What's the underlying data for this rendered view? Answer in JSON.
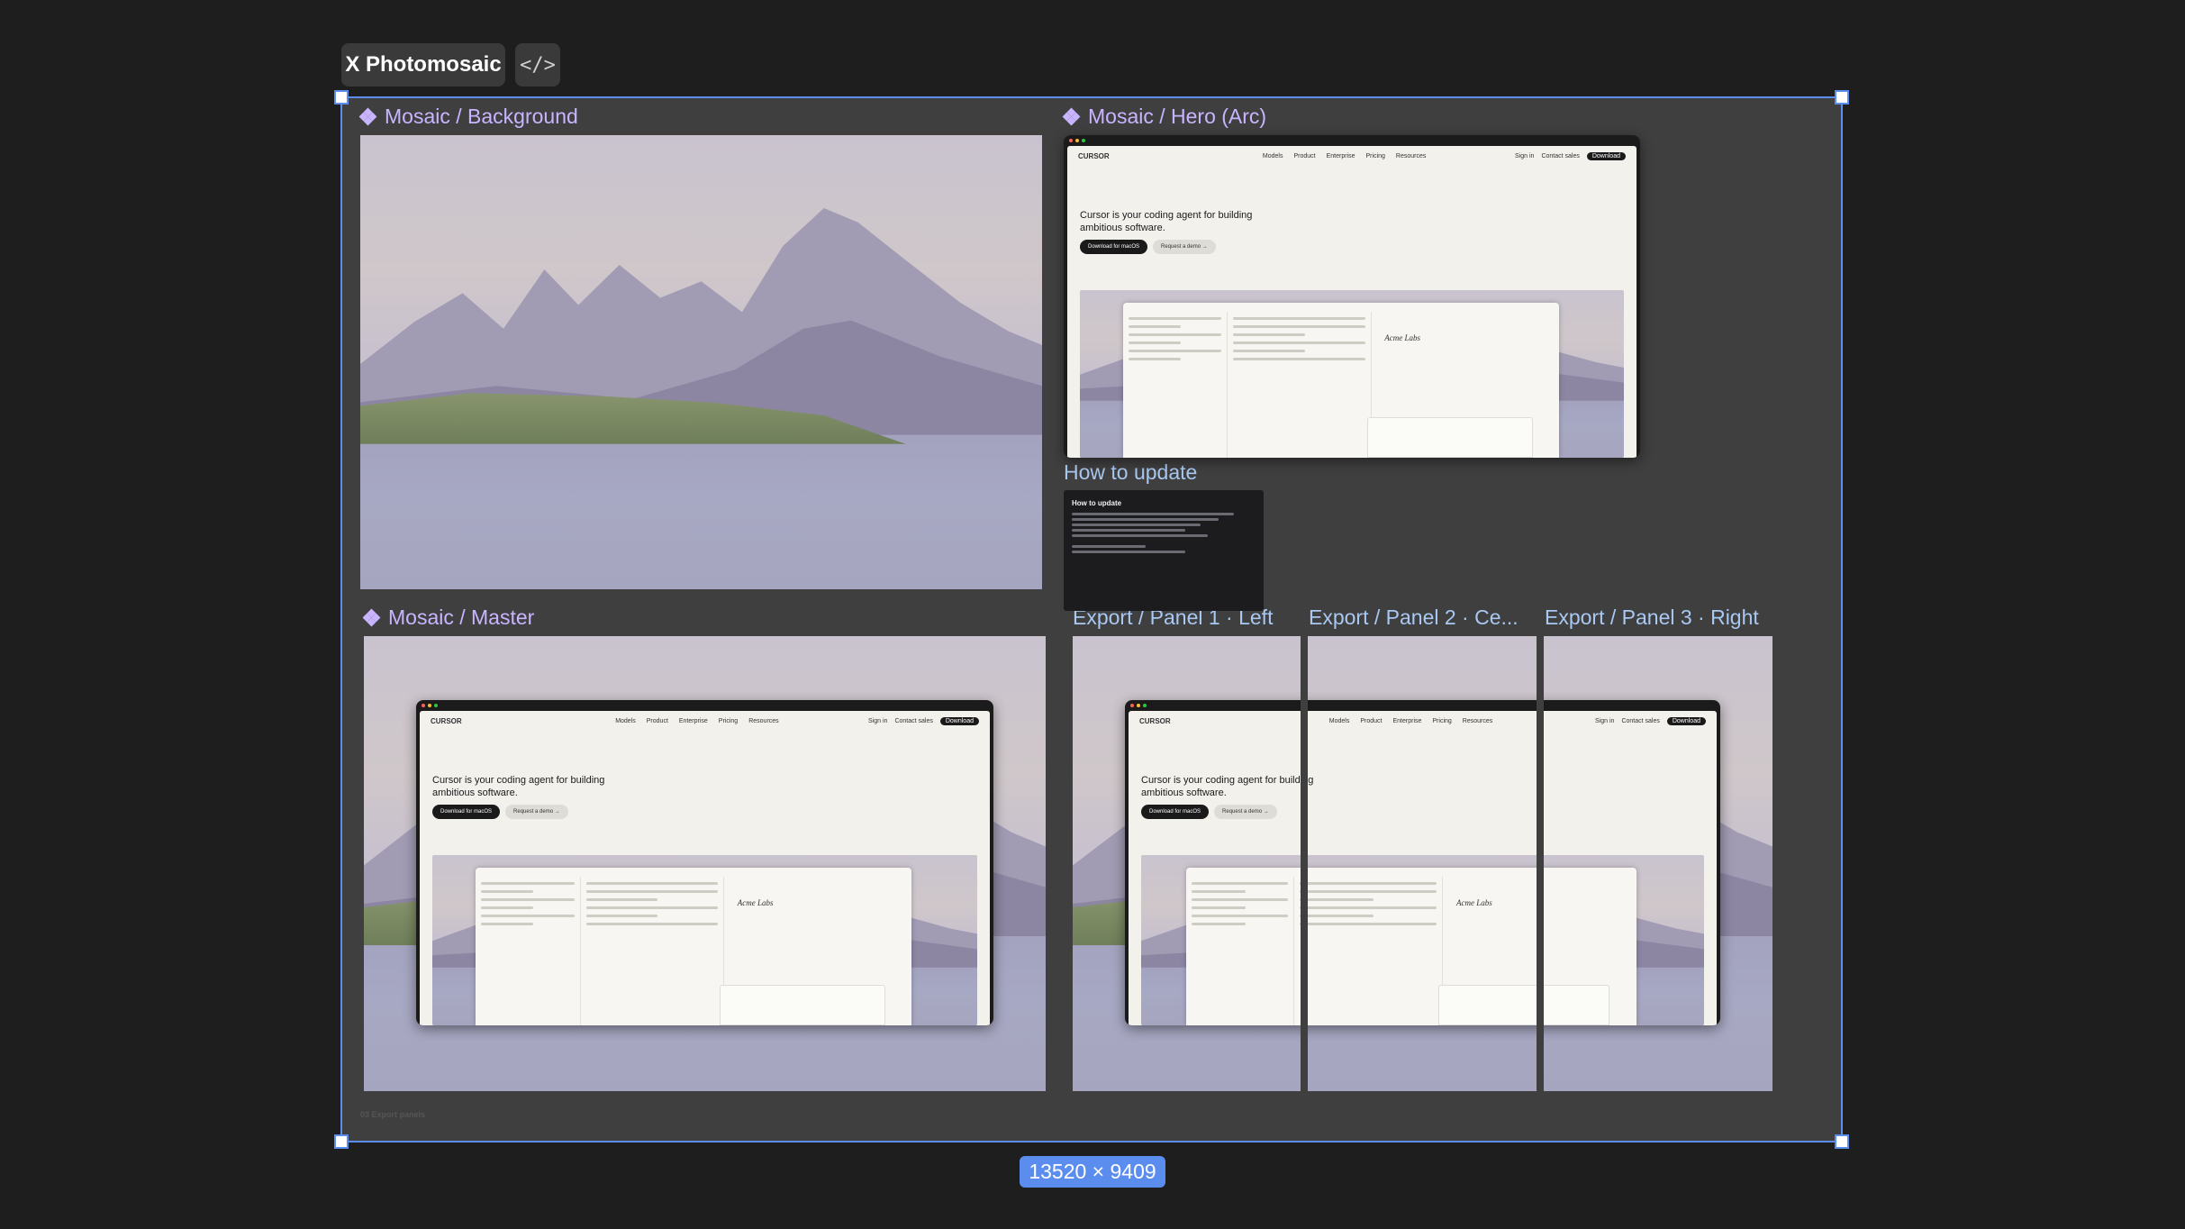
{
  "toolbar": {
    "frame_name": "X Photomosaic",
    "code_icon": "</>"
  },
  "frame": {
    "size_readout": "13520 × 9409"
  },
  "frames": {
    "background": "Mosaic / Background",
    "hero": "Mosaic / Hero (Arc)",
    "how_to": "How to update",
    "master": "Mosaic / Master",
    "panel1": "Export / Panel 1 · Left",
    "panel2": "Export / Panel 2 · Ce...",
    "panel3": "Export / Panel 3 · Right"
  },
  "how_to_card": {
    "title": "How to update"
  },
  "footnote": "03 Export panels",
  "mock_site": {
    "brand": "CURSOR",
    "nav": [
      "Models",
      "Product",
      "Enterprise",
      "Pricing",
      "Resources"
    ],
    "sign_in": "Sign in",
    "contact": "Contact sales",
    "download": "Download",
    "headline": "Cursor is your coding agent for building ambitious software.",
    "cta_primary": "Download for macOS",
    "cta_secondary": "Request a demo →",
    "doc_title": "Acme Labs"
  },
  "colors": {
    "selection": "#5b8def",
    "component": "#c9b5ff",
    "canvas": "#1e1e1e",
    "frame_fill": "#3f3f3f"
  },
  "icons": [
    "component-icon",
    "code-icon"
  ]
}
